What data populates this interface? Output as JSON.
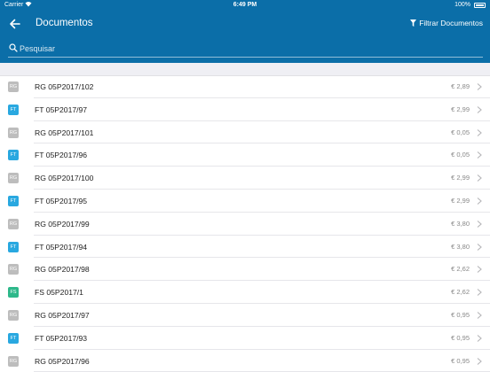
{
  "status_bar": {
    "carrier": "Carrier",
    "time": "6:49 PM",
    "battery": "100%"
  },
  "header": {
    "title": "Documentos",
    "filter_label": "Filtrar Documentos"
  },
  "search": {
    "placeholder": "Pesquisar"
  },
  "colors": {
    "header_bg": "#0b6ea8",
    "badge_RG": "#bdbdbd",
    "badge_FT": "#29a8e0",
    "badge_FS": "#2eb88a"
  },
  "icons": {
    "back": "back-arrow-icon",
    "filter": "filter-funnel-icon",
    "search": "search-icon",
    "row": "chevron-right-icon"
  },
  "documents": [
    {
      "type": "RG",
      "name": "RG 05P2017/102",
      "amount": "€ 2,89"
    },
    {
      "type": "FT",
      "name": "FT 05P2017/97",
      "amount": "€ 2,99"
    },
    {
      "type": "RG",
      "name": "RG 05P2017/101",
      "amount": "€ 0,05"
    },
    {
      "type": "FT",
      "name": "FT 05P2017/96",
      "amount": "€ 0,05"
    },
    {
      "type": "RG",
      "name": "RG 05P2017/100",
      "amount": "€ 2,99"
    },
    {
      "type": "FT",
      "name": "FT 05P2017/95",
      "amount": "€ 2,99"
    },
    {
      "type": "RG",
      "name": "RG 05P2017/99",
      "amount": "€ 3,80"
    },
    {
      "type": "FT",
      "name": "FT 05P2017/94",
      "amount": "€ 3,80"
    },
    {
      "type": "RG",
      "name": "RG 05P2017/98",
      "amount": "€ 2,62"
    },
    {
      "type": "FS",
      "name": "FS 05P2017/1",
      "amount": "€ 2,62"
    },
    {
      "type": "RG",
      "name": "RG 05P2017/97",
      "amount": "€ 0,95"
    },
    {
      "type": "FT",
      "name": "FT 05P2017/93",
      "amount": "€ 0,95"
    },
    {
      "type": "RG",
      "name": "RG 05P2017/96",
      "amount": "€ 0,95"
    }
  ]
}
